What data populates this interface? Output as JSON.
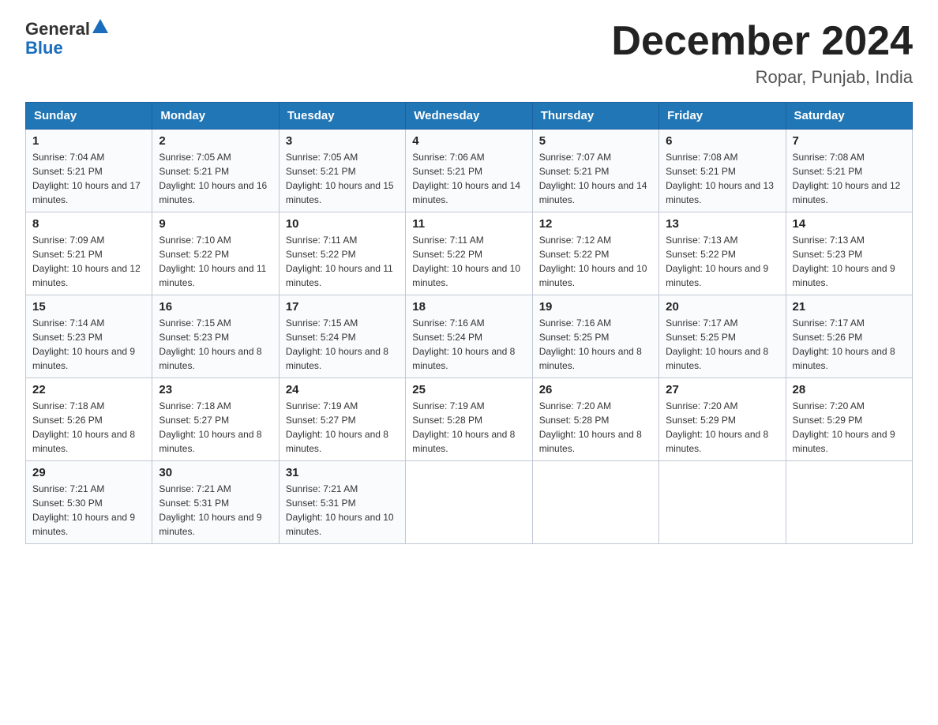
{
  "header": {
    "logo_general": "General",
    "logo_blue": "Blue",
    "title": "December 2024",
    "subtitle": "Ropar, Punjab, India"
  },
  "days_of_week": [
    "Sunday",
    "Monday",
    "Tuesday",
    "Wednesday",
    "Thursday",
    "Friday",
    "Saturday"
  ],
  "weeks": [
    [
      {
        "day": "1",
        "sunrise": "Sunrise: 7:04 AM",
        "sunset": "Sunset: 5:21 PM",
        "daylight": "Daylight: 10 hours and 17 minutes."
      },
      {
        "day": "2",
        "sunrise": "Sunrise: 7:05 AM",
        "sunset": "Sunset: 5:21 PM",
        "daylight": "Daylight: 10 hours and 16 minutes."
      },
      {
        "day": "3",
        "sunrise": "Sunrise: 7:05 AM",
        "sunset": "Sunset: 5:21 PM",
        "daylight": "Daylight: 10 hours and 15 minutes."
      },
      {
        "day": "4",
        "sunrise": "Sunrise: 7:06 AM",
        "sunset": "Sunset: 5:21 PM",
        "daylight": "Daylight: 10 hours and 14 minutes."
      },
      {
        "day": "5",
        "sunrise": "Sunrise: 7:07 AM",
        "sunset": "Sunset: 5:21 PM",
        "daylight": "Daylight: 10 hours and 14 minutes."
      },
      {
        "day": "6",
        "sunrise": "Sunrise: 7:08 AM",
        "sunset": "Sunset: 5:21 PM",
        "daylight": "Daylight: 10 hours and 13 minutes."
      },
      {
        "day": "7",
        "sunrise": "Sunrise: 7:08 AM",
        "sunset": "Sunset: 5:21 PM",
        "daylight": "Daylight: 10 hours and 12 minutes."
      }
    ],
    [
      {
        "day": "8",
        "sunrise": "Sunrise: 7:09 AM",
        "sunset": "Sunset: 5:21 PM",
        "daylight": "Daylight: 10 hours and 12 minutes."
      },
      {
        "day": "9",
        "sunrise": "Sunrise: 7:10 AM",
        "sunset": "Sunset: 5:22 PM",
        "daylight": "Daylight: 10 hours and 11 minutes."
      },
      {
        "day": "10",
        "sunrise": "Sunrise: 7:11 AM",
        "sunset": "Sunset: 5:22 PM",
        "daylight": "Daylight: 10 hours and 11 minutes."
      },
      {
        "day": "11",
        "sunrise": "Sunrise: 7:11 AM",
        "sunset": "Sunset: 5:22 PM",
        "daylight": "Daylight: 10 hours and 10 minutes."
      },
      {
        "day": "12",
        "sunrise": "Sunrise: 7:12 AM",
        "sunset": "Sunset: 5:22 PM",
        "daylight": "Daylight: 10 hours and 10 minutes."
      },
      {
        "day": "13",
        "sunrise": "Sunrise: 7:13 AM",
        "sunset": "Sunset: 5:22 PM",
        "daylight": "Daylight: 10 hours and 9 minutes."
      },
      {
        "day": "14",
        "sunrise": "Sunrise: 7:13 AM",
        "sunset": "Sunset: 5:23 PM",
        "daylight": "Daylight: 10 hours and 9 minutes."
      }
    ],
    [
      {
        "day": "15",
        "sunrise": "Sunrise: 7:14 AM",
        "sunset": "Sunset: 5:23 PM",
        "daylight": "Daylight: 10 hours and 9 minutes."
      },
      {
        "day": "16",
        "sunrise": "Sunrise: 7:15 AM",
        "sunset": "Sunset: 5:23 PM",
        "daylight": "Daylight: 10 hours and 8 minutes."
      },
      {
        "day": "17",
        "sunrise": "Sunrise: 7:15 AM",
        "sunset": "Sunset: 5:24 PM",
        "daylight": "Daylight: 10 hours and 8 minutes."
      },
      {
        "day": "18",
        "sunrise": "Sunrise: 7:16 AM",
        "sunset": "Sunset: 5:24 PM",
        "daylight": "Daylight: 10 hours and 8 minutes."
      },
      {
        "day": "19",
        "sunrise": "Sunrise: 7:16 AM",
        "sunset": "Sunset: 5:25 PM",
        "daylight": "Daylight: 10 hours and 8 minutes."
      },
      {
        "day": "20",
        "sunrise": "Sunrise: 7:17 AM",
        "sunset": "Sunset: 5:25 PM",
        "daylight": "Daylight: 10 hours and 8 minutes."
      },
      {
        "day": "21",
        "sunrise": "Sunrise: 7:17 AM",
        "sunset": "Sunset: 5:26 PM",
        "daylight": "Daylight: 10 hours and 8 minutes."
      }
    ],
    [
      {
        "day": "22",
        "sunrise": "Sunrise: 7:18 AM",
        "sunset": "Sunset: 5:26 PM",
        "daylight": "Daylight: 10 hours and 8 minutes."
      },
      {
        "day": "23",
        "sunrise": "Sunrise: 7:18 AM",
        "sunset": "Sunset: 5:27 PM",
        "daylight": "Daylight: 10 hours and 8 minutes."
      },
      {
        "day": "24",
        "sunrise": "Sunrise: 7:19 AM",
        "sunset": "Sunset: 5:27 PM",
        "daylight": "Daylight: 10 hours and 8 minutes."
      },
      {
        "day": "25",
        "sunrise": "Sunrise: 7:19 AM",
        "sunset": "Sunset: 5:28 PM",
        "daylight": "Daylight: 10 hours and 8 minutes."
      },
      {
        "day": "26",
        "sunrise": "Sunrise: 7:20 AM",
        "sunset": "Sunset: 5:28 PM",
        "daylight": "Daylight: 10 hours and 8 minutes."
      },
      {
        "day": "27",
        "sunrise": "Sunrise: 7:20 AM",
        "sunset": "Sunset: 5:29 PM",
        "daylight": "Daylight: 10 hours and 8 minutes."
      },
      {
        "day": "28",
        "sunrise": "Sunrise: 7:20 AM",
        "sunset": "Sunset: 5:29 PM",
        "daylight": "Daylight: 10 hours and 9 minutes."
      }
    ],
    [
      {
        "day": "29",
        "sunrise": "Sunrise: 7:21 AM",
        "sunset": "Sunset: 5:30 PM",
        "daylight": "Daylight: 10 hours and 9 minutes."
      },
      {
        "day": "30",
        "sunrise": "Sunrise: 7:21 AM",
        "sunset": "Sunset: 5:31 PM",
        "daylight": "Daylight: 10 hours and 9 minutes."
      },
      {
        "day": "31",
        "sunrise": "Sunrise: 7:21 AM",
        "sunset": "Sunset: 5:31 PM",
        "daylight": "Daylight: 10 hours and 10 minutes."
      },
      null,
      null,
      null,
      null
    ]
  ]
}
